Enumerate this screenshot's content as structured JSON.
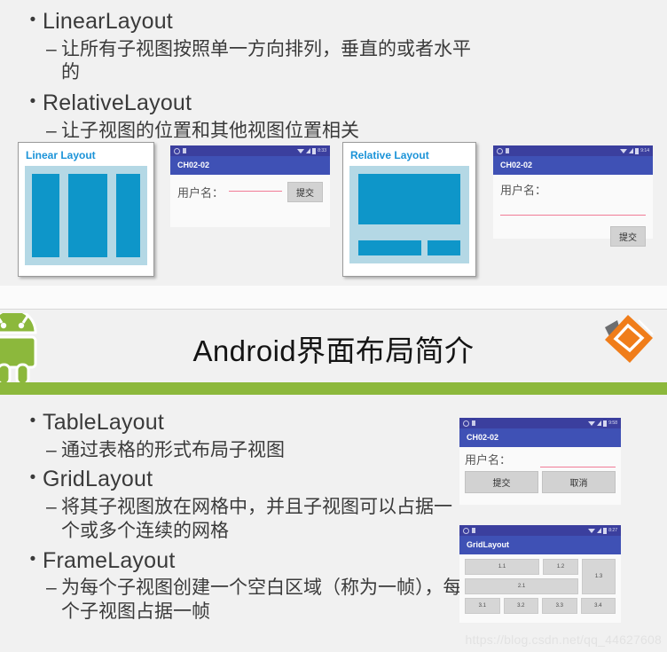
{
  "slide": {
    "banner_title": "Android界面布局简介",
    "watermark": "https://blog.csdn.net/qq_44627608",
    "accent_green": "#8cb83c",
    "accent_blue": "#1b93d8",
    "android_blue": "#3f51b5",
    "diagram_blue": "#0e96c9"
  },
  "top_section": {
    "bullets": [
      {
        "title": "LinearLayout",
        "detail": "让所有子视图按照单一方向排列，垂直的或者水平的"
      },
      {
        "title": "RelativeLayout",
        "detail": "让子视图的位置和其他视图位置相关"
      }
    ],
    "diagrams": [
      {
        "title": "Linear Layout"
      },
      {
        "title": "Relative Layout"
      }
    ],
    "phone_linear": {
      "app_title": "CH02-02",
      "status_time": "8:33",
      "label": "用户名：",
      "submit": "提交"
    },
    "phone_relative": {
      "app_title": "CH02-02",
      "status_time": "9:14",
      "label": "用户名：",
      "submit": "提交"
    }
  },
  "bottom_section": {
    "bullets": [
      {
        "title": "TableLayout",
        "detail": "通过表格的形式布局子视图"
      },
      {
        "title": "GridLayout",
        "detail": "将其子视图放在网格中，并且子视图可以占据一个或多个连续的网格"
      },
      {
        "title": "FrameLayout",
        "detail": "为每个子视图创建一个空白区域（称为一帧），每个子视图占据一帧"
      }
    ],
    "phone_table": {
      "app_title": "CH02-02",
      "status_time": "9:58",
      "label": "用户名：",
      "submit": "提交",
      "cancel": "取消"
    },
    "phone_grid": {
      "app_title": "GridLayout",
      "status_time": "8:27",
      "cells": {
        "c11": "1.1",
        "c12": "1.2",
        "c13": "1.3",
        "c21": "2.1",
        "c31": "3.1",
        "c32": "3.2",
        "c33": "3.3",
        "c34": "3.4"
      }
    }
  }
}
